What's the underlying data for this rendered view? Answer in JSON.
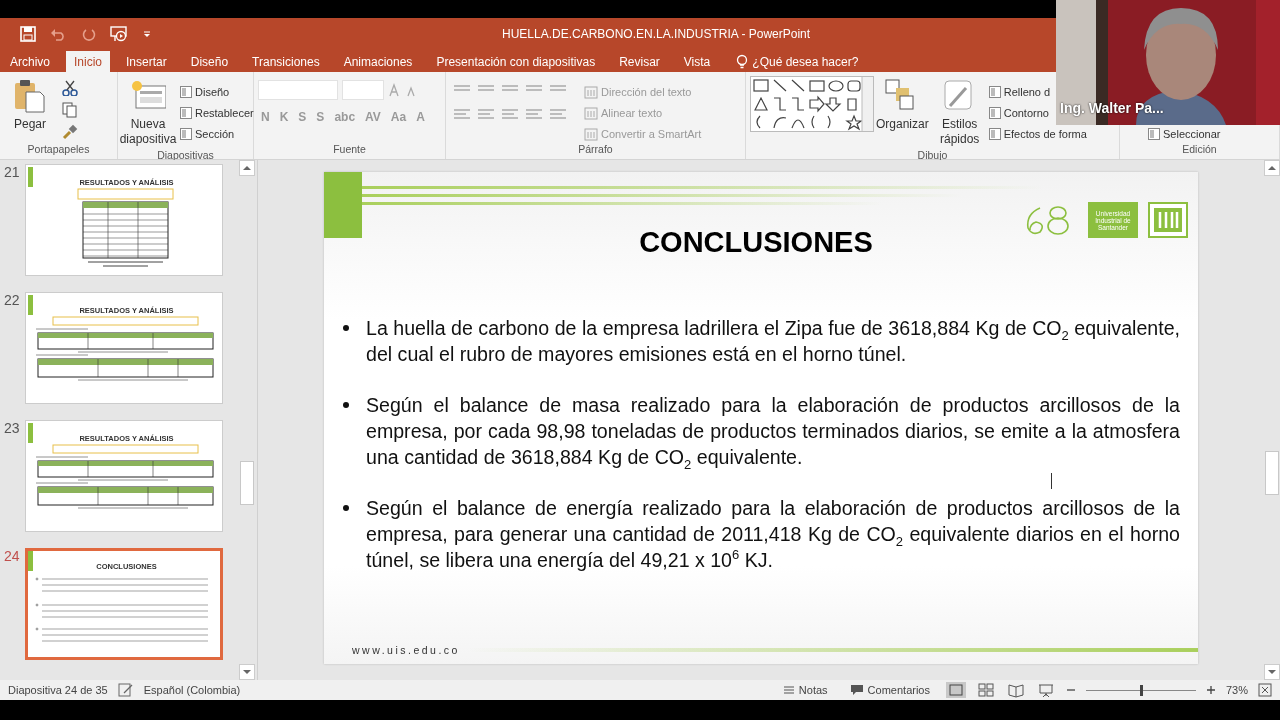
{
  "window": {
    "title": "HUELLA.DE.CARBONO.EN.LA.INDUSTRIA - PowerPoint"
  },
  "tabs": [
    {
      "label": "Archivo",
      "selected": false
    },
    {
      "label": "Inicio",
      "selected": true
    },
    {
      "label": "Insertar",
      "selected": false
    },
    {
      "label": "Diseño",
      "selected": false
    },
    {
      "label": "Transiciones",
      "selected": false
    },
    {
      "label": "Animaciones",
      "selected": false
    },
    {
      "label": "Presentación con diapositivas",
      "selected": false
    },
    {
      "label": "Revisar",
      "selected": false
    },
    {
      "label": "Vista",
      "selected": false
    }
  ],
  "tell_me": "¿Qué desea hacer?",
  "ribbon": [
    {
      "label": "Portapapeles",
      "items": [
        {
          "kind": "paste",
          "label": "Pegar"
        },
        {
          "kind": "clipboard"
        }
      ]
    },
    {
      "label": "Diapositivas",
      "items": [
        {
          "kind": "newslide",
          "label": "Nueva diapositiva"
        },
        {
          "kind": "list",
          "entries": [
            "Diseño",
            "Restablecer",
            "Sección"
          ]
        }
      ]
    },
    {
      "label": "Fuente",
      "items": [
        {
          "kind": "font",
          "row": [
            "N",
            "K",
            "S",
            "S",
            "abc",
            "AV",
            "Aa",
            "A"
          ]
        }
      ]
    },
    {
      "label": "Párrafo",
      "items": [
        {
          "kind": "para",
          "entries": [
            "Dirección del texto",
            "Alinear texto",
            "Convertir a SmartArt"
          ]
        }
      ]
    },
    {
      "label": "Dibujo",
      "items": [
        {
          "kind": "gallery"
        },
        {
          "kind": "arrange",
          "label": "Organizar"
        },
        {
          "kind": "styles",
          "label": "Estilos rápidos"
        },
        {
          "kind": "list",
          "entries": [
            "Relleno d",
            "Contorno",
            "Efectos de forma"
          ]
        }
      ]
    },
    {
      "label": "Edición",
      "items": [
        {
          "kind": "lowlist",
          "entries": [
            "Seleccionar"
          ]
        }
      ]
    }
  ],
  "thumbnails": [
    {
      "number": "21",
      "title": "RESULTADOS Y ANÁLISIS",
      "kind": "table",
      "selected": false
    },
    {
      "number": "22",
      "title": "RESULTADOS Y ANÁLISIS",
      "kind": "tables",
      "selected": false
    },
    {
      "number": "23",
      "title": "RESULTADOS Y ANÁLISIS",
      "kind": "tables",
      "selected": false
    },
    {
      "number": "24",
      "title": "CONCLUSIONES",
      "kind": "bullets",
      "selected": true
    }
  ],
  "slide": {
    "title": "CONCLUSIONES",
    "logo_text": "Universidad Industrial de Santander",
    "bullets": [
      "La huella de carbono de la empresa ladrillera el Zipa fue de 3618,884 Kg de CO$_{2}$ equivalente, del cual el rubro de mayores emisiones está en el horno túnel.",
      "Según el balance de masa realizado para la elaboración de productos arcillosos de la empresa, por cada 98,98 toneladas de productos terminados diarios, se emite a la atmosfera una cantidad de 3618,884 Kg de CO$_{2}$ equivalente.",
      "Según el balance de energía realizado para la elaboración de productos arcillosos de la empresa, para generar una cantidad de 2011,418 Kg de CO$_{2}$ equivalente diarios en el horno túnel, se libera una energía del 49,21 x 10$^{6}$ KJ."
    ],
    "footer": "www.uis.edu.co"
  },
  "status_bar": {
    "slide_info": "Diapositiva 24 de 35",
    "language": "Español (Colombia)",
    "notes": "Notas",
    "comments": "Comentarios",
    "zoom": "73%",
    "zoom_slider": {
      "level": 0.5
    }
  },
  "webcam": {
    "name": "Ing. Walter Pa..."
  }
}
